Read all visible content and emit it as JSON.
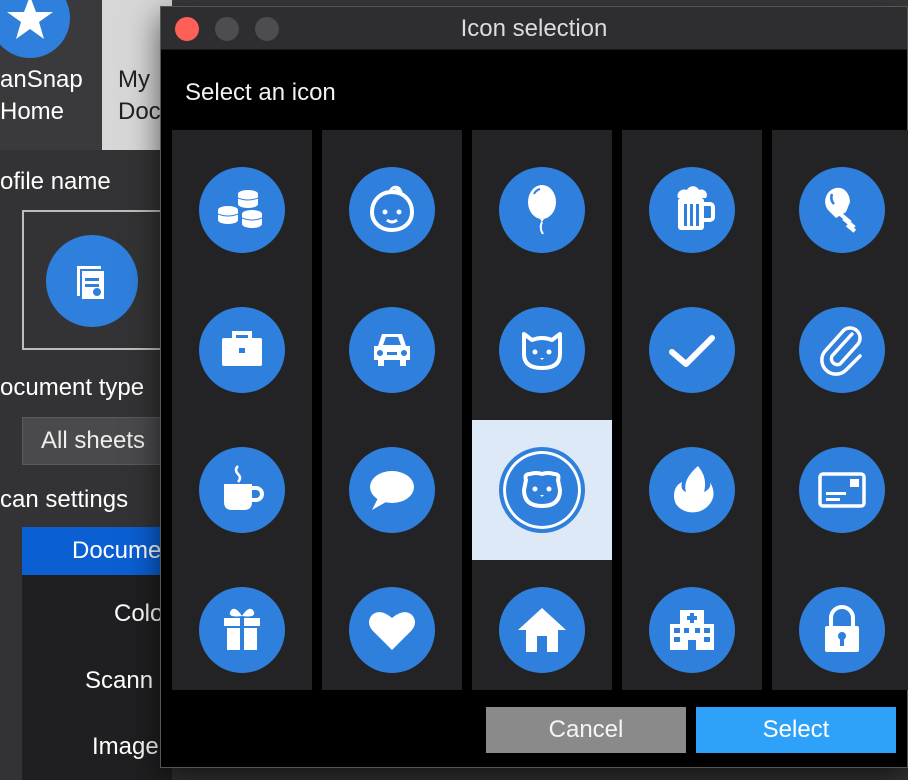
{
  "background": {
    "apps": [
      {
        "line1": "anSnap",
        "line2": "Home"
      },
      {
        "line1": "My",
        "line2": "Doc"
      }
    ],
    "profile_name_label": "ofile name",
    "document_type_label": "ocument type",
    "document_type_value": "All sheets",
    "scan_settings_label": "can settings",
    "settings_items": [
      "Docume",
      "Colo",
      "Scann",
      "Image"
    ]
  },
  "dialog": {
    "title": "Icon selection",
    "subtitle": "Select an icon",
    "icons": [
      [
        "coins-icon",
        "baby-icon",
        "balloon-icon",
        "beer-icon",
        "lightbulb-icon"
      ],
      [
        "briefcase-icon",
        "car-icon",
        "cat-icon",
        "checkmark-icon",
        "paperclip-icon"
      ],
      [
        "coffee-icon",
        "speech-bubble-icon",
        "dog-icon",
        "flame-icon",
        "postcard-icon"
      ],
      [
        "gift-icon",
        "heart-icon",
        "house-icon",
        "hospital-icon",
        "lock-icon"
      ]
    ],
    "selected_icon": "dog-icon",
    "cancel_label": "Cancel",
    "select_label": "Select"
  },
  "colors": {
    "icon_blue": "#2f7fdc",
    "select_button": "#2ea2f8",
    "cancel_button": "#8a8a8a",
    "selected_cell": "#dde9f7",
    "close_red": "#fe5f57"
  }
}
